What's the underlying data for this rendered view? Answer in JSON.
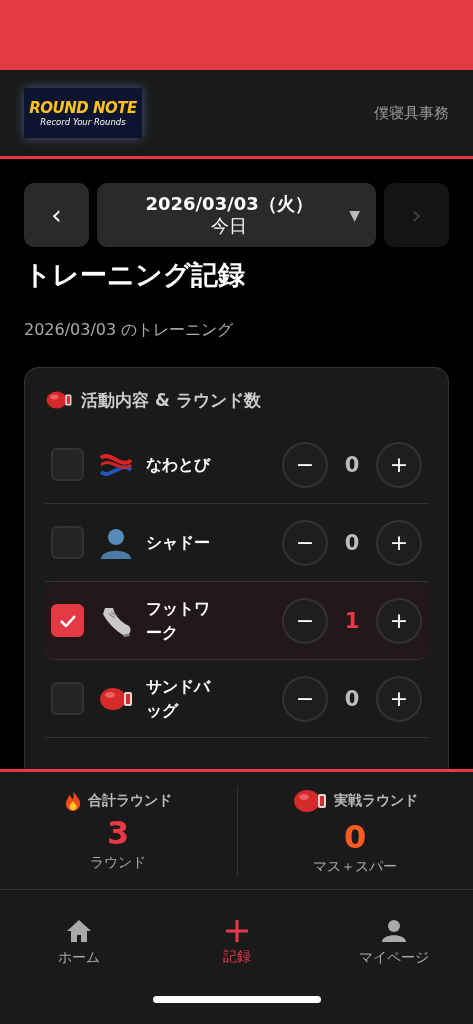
{
  "header": {
    "logo_title": "ROUND NOTE",
    "logo_tagline": "Record Your Rounds",
    "user_name": "僕寝具事務"
  },
  "date_nav": {
    "prev": "‹",
    "date": "2026/03/03（火）",
    "relative": "今日",
    "dropdown": "▼",
    "next": "›",
    "next_disabled": true
  },
  "title": "トレーニング記録",
  "subtitle": "2026/03/03 のトレーニング",
  "activities": {
    "heading": "活動内容 & ラウンド数",
    "items": [
      {
        "kind": "rope",
        "name": "なわとび",
        "checked": false,
        "count": "0"
      },
      {
        "kind": "person",
        "name": "シャドー",
        "checked": false,
        "count": "0"
      },
      {
        "kind": "shoe",
        "name": "フットワーク",
        "checked": true,
        "count": "1"
      },
      {
        "kind": "glove",
        "name": "サンドバッグ",
        "checked": false,
        "count": "0"
      }
    ],
    "minus": "−",
    "plus": "+"
  },
  "summary": [
    {
      "kind": "fire",
      "label": "合計ラウンド",
      "value": "3",
      "unit": "ラウンド",
      "color": "#e63946"
    },
    {
      "kind": "glove",
      "label": "実戦ラウンド",
      "value": "0",
      "unit": "マス＋スパー",
      "color": "#ff5a1f"
    }
  ],
  "tabs": [
    {
      "kind": "home",
      "label": "ホーム",
      "selected": false
    },
    {
      "kind": "plus",
      "label": "記録",
      "selected": true
    },
    {
      "kind": "person",
      "label": "マイページ",
      "selected": false
    }
  ]
}
